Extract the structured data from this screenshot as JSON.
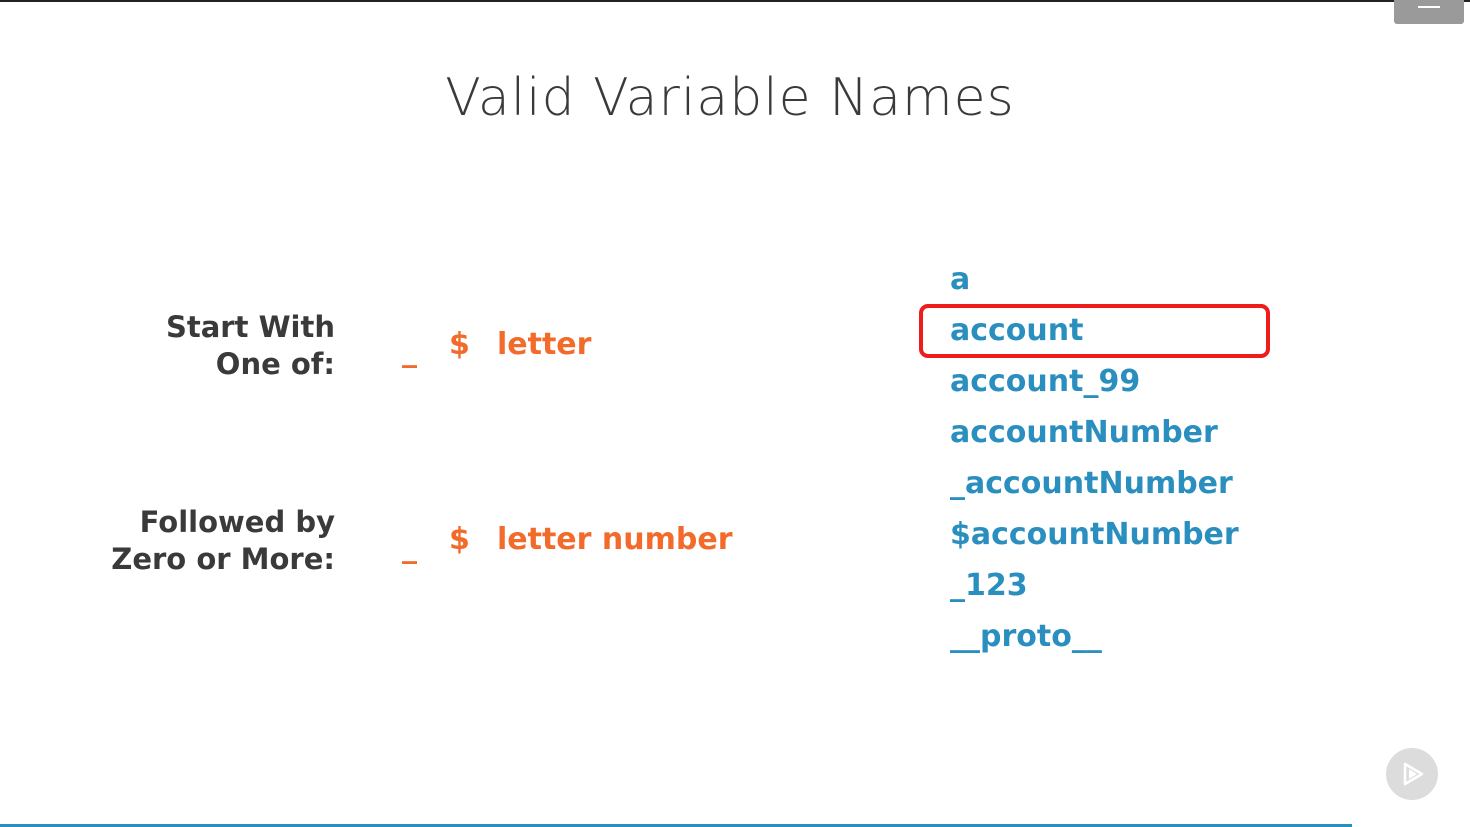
{
  "slide": {
    "title": "Valid Variable Names",
    "rules": {
      "start": {
        "label_line1": "Start With",
        "label_line2": "One of:",
        "tokens": [
          "_",
          "$",
          "letter"
        ]
      },
      "follow": {
        "label_line1": "Followed by",
        "label_line2": "Zero or More:",
        "tokens": [
          "_",
          "$",
          "letter number"
        ]
      }
    },
    "examples": [
      "a",
      "account",
      "account_99",
      "accountNumber",
      "_accountNumber",
      "$accountNumber",
      "_123",
      "__proto__"
    ],
    "highlighted_example": "account"
  },
  "controls": {
    "menu_icon": "hamburger-menu-icon",
    "play_icon": "play-icon"
  },
  "colors": {
    "title": "#3a3a3a",
    "label": "#3a3a3a",
    "token": "#f26b2b",
    "example": "#2a8fbf",
    "highlight": "#ef1c1c",
    "bottom_rule": "#2a8fbf"
  }
}
